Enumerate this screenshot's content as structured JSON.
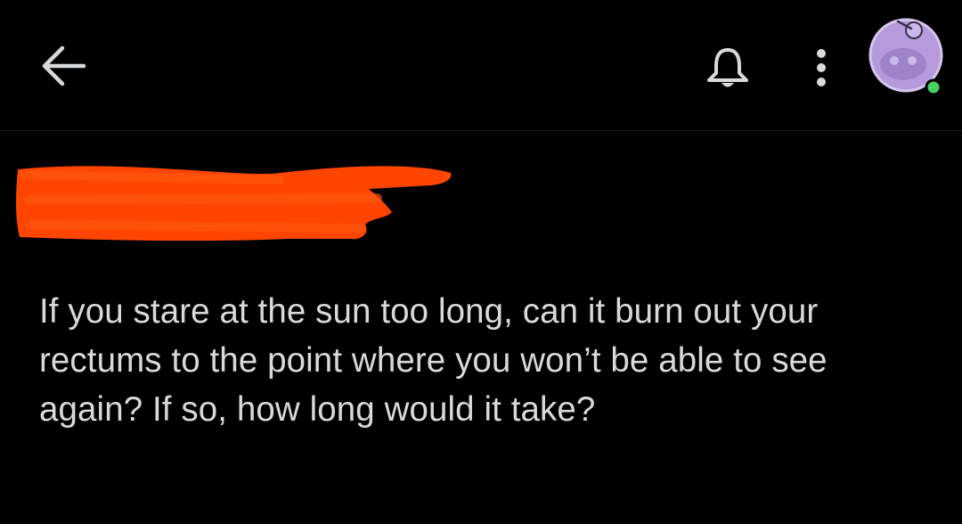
{
  "header": {
    "icons": {
      "back": "back-arrow-icon",
      "notifications": "bell-icon",
      "more": "more-vertical-icon",
      "avatar": "user-avatar-icon"
    },
    "online_status": "online"
  },
  "post": {
    "author_redacted": true,
    "title": "If you stare at the sun too long, can it burn out your rectums to the point where you won’t be able to see again? If so, how long would it take?"
  },
  "colors": {
    "background": "#000000",
    "text": "#d7dadc",
    "icon": "#d7dadc",
    "redaction": "#ff4500",
    "avatar_fill": "#b59bdc",
    "avatar_ring": "#d5c6ee",
    "online_dot": "#46d160"
  }
}
